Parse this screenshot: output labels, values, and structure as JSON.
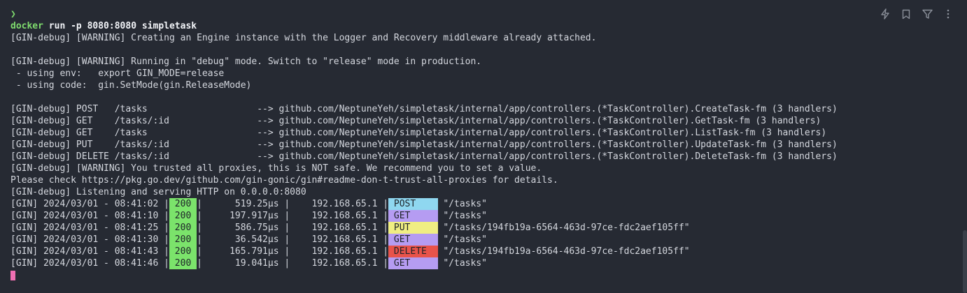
{
  "prompt_symbol": "❯",
  "command": {
    "bin": "docker",
    "args": " run -p 8080:8080 simpletask"
  },
  "output": {
    "warn_engine": "[GIN-debug] [WARNING] Creating an Engine instance with the Logger and Recovery middleware already attached.",
    "warn_debug": "[GIN-debug] [WARNING] Running in \"debug\" mode. Switch to \"release\" mode in production.",
    "using_env": " - using env:   export GIN_MODE=release",
    "using_code": " - using code:  gin.SetMode(gin.ReleaseMode)",
    "routes": [
      "[GIN-debug] POST   /tasks                    --> github.com/NeptuneYeh/simpletask/internal/app/controllers.(*TaskController).CreateTask-fm (3 handlers)",
      "[GIN-debug] GET    /tasks/:id                --> github.com/NeptuneYeh/simpletask/internal/app/controllers.(*TaskController).GetTask-fm (3 handlers)",
      "[GIN-debug] GET    /tasks                    --> github.com/NeptuneYeh/simpletask/internal/app/controllers.(*TaskController).ListTask-fm (3 handlers)",
      "[GIN-debug] PUT    /tasks/:id                --> github.com/NeptuneYeh/simpletask/internal/app/controllers.(*TaskController).UpdateTask-fm (3 handlers)",
      "[GIN-debug] DELETE /tasks/:id                --> github.com/NeptuneYeh/simpletask/internal/app/controllers.(*TaskController).DeleteTask-fm (3 handlers)"
    ],
    "warn_proxies": "[GIN-debug] [WARNING] You trusted all proxies, this is NOT safe. We recommend you to set a value.",
    "please_check": "Please check https://pkg.go.dev/github.com/gin-gonic/gin#readme-don-t-trust-all-proxies for details.",
    "listening": "[GIN-debug] Listening and serving HTTP on 0.0.0.0:8080",
    "requests": [
      {
        "prefix": "[GIN] 2024/03/01 - 08:41:02 |",
        "status": " 200 ",
        "mid": "|      519.25µs |    192.168.65.1 |",
        "method": " POST    ",
        "path": " \"/tasks\""
      },
      {
        "prefix": "[GIN] 2024/03/01 - 08:41:10 |",
        "status": " 200 ",
        "mid": "|     197.917µs |    192.168.65.1 |",
        "method": " GET     ",
        "path": " \"/tasks\""
      },
      {
        "prefix": "[GIN] 2024/03/01 - 08:41:25 |",
        "status": " 200 ",
        "mid": "|      586.75µs |    192.168.65.1 |",
        "method": " PUT     ",
        "path": " \"/tasks/194fb19a-6564-463d-97ce-fdc2aef105ff\""
      },
      {
        "prefix": "[GIN] 2024/03/01 - 08:41:30 |",
        "status": " 200 ",
        "mid": "|      36.542µs |    192.168.65.1 |",
        "method": " GET     ",
        "path": " \"/tasks\""
      },
      {
        "prefix": "[GIN] 2024/03/01 - 08:41:43 |",
        "status": " 200 ",
        "mid": "|     165.791µs |    192.168.65.1 |",
        "method": " DELETE  ",
        "path": " \"/tasks/194fb19a-6564-463d-97ce-fdc2aef105ff\""
      },
      {
        "prefix": "[GIN] 2024/03/01 - 08:41:46 |",
        "status": " 200 ",
        "mid": "|      19.041µs |    192.168.65.1 |",
        "method": " GET     ",
        "path": " \"/tasks\""
      }
    ]
  },
  "colors": {
    "background": "#262a33",
    "status_ok": "#7be36b",
    "post": "#8fd7f0",
    "get": "#b59cf2",
    "put": "#f0ee82",
    "delete": "#e8534a",
    "cursor": "#ef6fb2"
  },
  "toolbar": {
    "icons": [
      "lightning-icon",
      "bookmark-icon",
      "filter-icon",
      "more-vertical-icon"
    ]
  }
}
